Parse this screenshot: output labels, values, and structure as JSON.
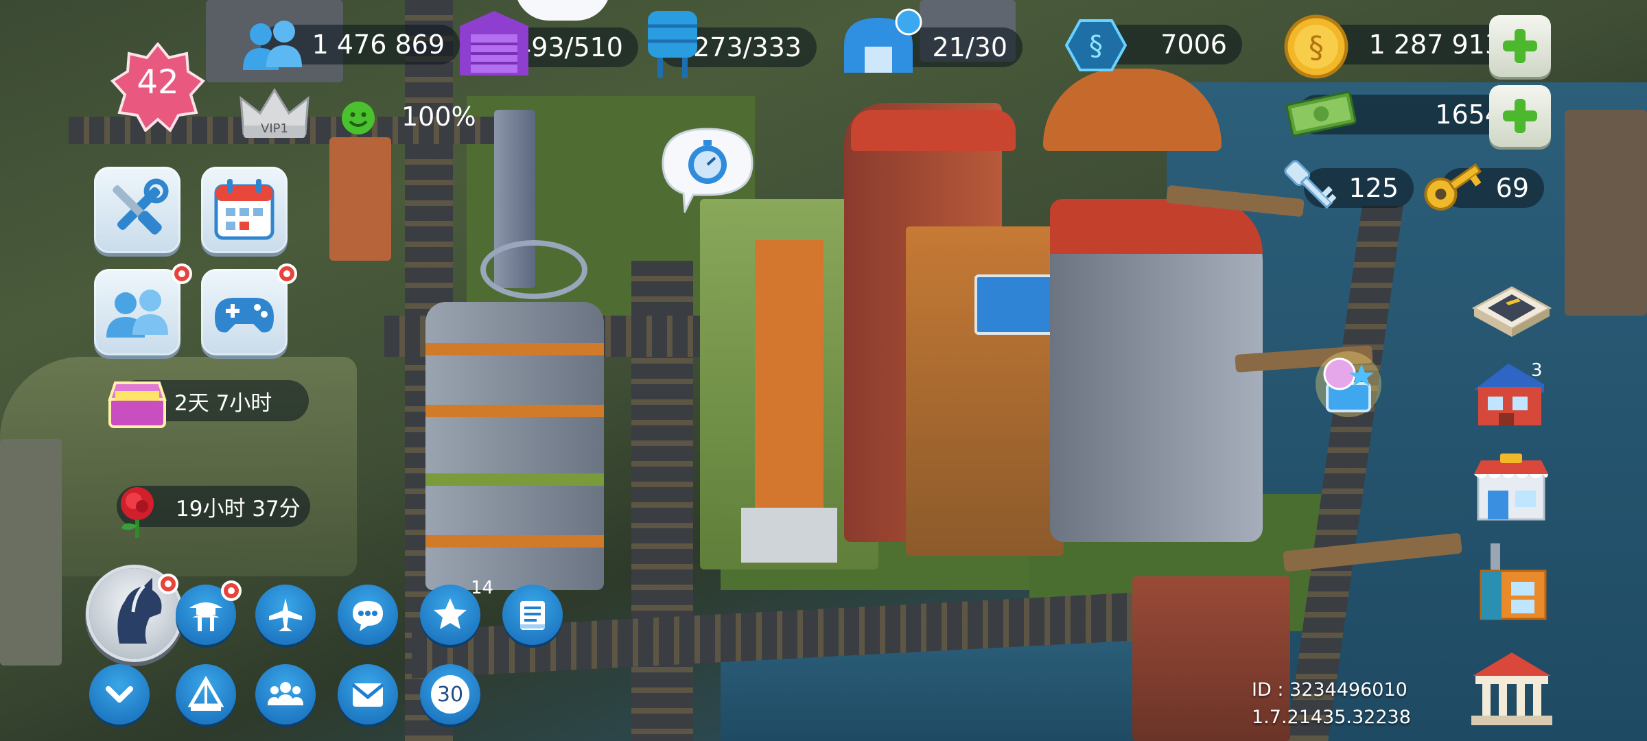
{
  "level": {
    "value": "42",
    "vip_label": "VIP1"
  },
  "resources": {
    "population": "1 476 869",
    "storage": "493/510",
    "water": "273/333",
    "specialists": "21/30",
    "simoleons_blue": "7006",
    "simcash_gold": "1 287 913",
    "happiness": "100%",
    "banknotes": "1654",
    "platinum_keys": "125",
    "golden_keys": "69"
  },
  "timers": {
    "chest": "2天 7小时",
    "rose": "19小时 37分"
  },
  "badges": {
    "star_count": "14",
    "level_30_label": "30",
    "cityhouse_count": "3"
  },
  "footer": {
    "id_label": "ID : 3234496010",
    "version": "1.7.21435.32238"
  },
  "colors": {
    "accent_blue": "#1f7fd1",
    "plus_green": "#4cb82d",
    "level_badge": "#e8587f",
    "gold": "#f2b829"
  }
}
